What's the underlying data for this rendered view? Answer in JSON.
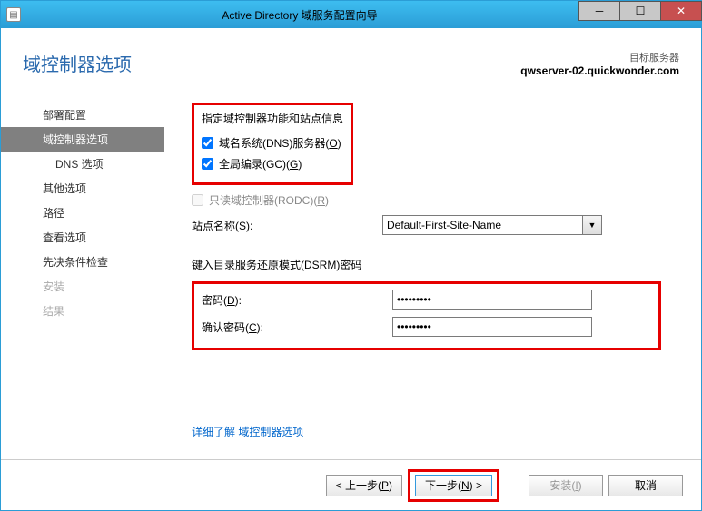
{
  "window": {
    "title": "Active Directory 域服务配置向导"
  },
  "header": {
    "page_title": "域控制器选项",
    "target_server_label": "目标服务器",
    "target_server_name": "qwserver-02.quickwonder.com"
  },
  "sidebar": {
    "items": [
      {
        "label": "部署配置",
        "active": false
      },
      {
        "label": "域控制器选项",
        "active": true
      },
      {
        "label": "DNS 选项",
        "active": false,
        "sub": true
      },
      {
        "label": "其他选项",
        "active": false
      },
      {
        "label": "路径",
        "active": false
      },
      {
        "label": "查看选项",
        "active": false
      },
      {
        "label": "先决条件检查",
        "active": false
      },
      {
        "label": "安装",
        "active": false,
        "disabled": true
      },
      {
        "label": "结果",
        "active": false,
        "disabled": true
      }
    ]
  },
  "main": {
    "section1_title": "指定域控制器功能和站点信息",
    "chk_dns": {
      "label": "域名系统(DNS)服务器(",
      "hotkey": "O",
      "suffix": ")",
      "checked": true
    },
    "chk_gc": {
      "label": "全局编录(GC)(",
      "hotkey": "G",
      "suffix": ")",
      "checked": true
    },
    "chk_rodc": {
      "label": "只读域控制器(RODC)(",
      "hotkey": "R",
      "suffix": ")",
      "checked": false
    },
    "site_label": "站点名称(",
    "site_hotkey": "S",
    "site_suffix": "):",
    "site_value": "Default-First-Site-Name",
    "section2_title": "键入目录服务还原模式(DSRM)密码",
    "pw_label": "密码(",
    "pw_hotkey": "D",
    "pw_suffix": "):",
    "pw_value": "•••••••••",
    "pw2_label": "确认密码(",
    "pw2_hotkey": "C",
    "pw2_suffix": "):",
    "pw2_value": "•••••••••",
    "learn_more_prefix": "详细了解",
    "learn_more_link": "域控制器选项"
  },
  "footer": {
    "prev": "< 上一步(",
    "prev_hotkey": "P",
    "prev_suffix": ")",
    "next": "下一步(",
    "next_hotkey": "N",
    "next_suffix": ") >",
    "install": "安装(",
    "install_hotkey": "I",
    "install_suffix": ")",
    "cancel": "取消"
  }
}
